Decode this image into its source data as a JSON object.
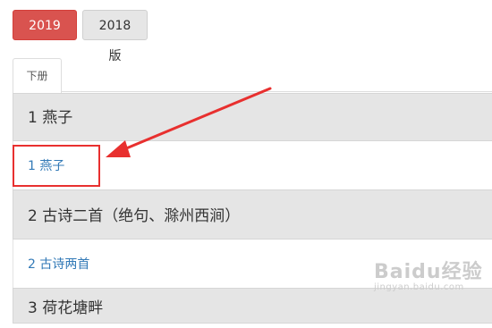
{
  "version_tabs": [
    {
      "label": "2019版",
      "active": true
    },
    {
      "label": "2018版",
      "active": false
    }
  ],
  "volume_tab": {
    "label": "下册"
  },
  "sections": [
    {
      "title": "1 燕子",
      "items": [
        "1 燕子"
      ]
    },
    {
      "title": "2 古诗二首（绝句、滁州西涧）",
      "items": [
        "2 古诗两首"
      ]
    },
    {
      "title": "3 荷花塘畔",
      "items": []
    }
  ],
  "watermark": {
    "main": "Baidu经验",
    "sub": "jingyan.baidu.com"
  },
  "colors": {
    "accent_red": "#d9534f",
    "link_blue": "#337ab7",
    "annotation_red": "#e8302f"
  }
}
